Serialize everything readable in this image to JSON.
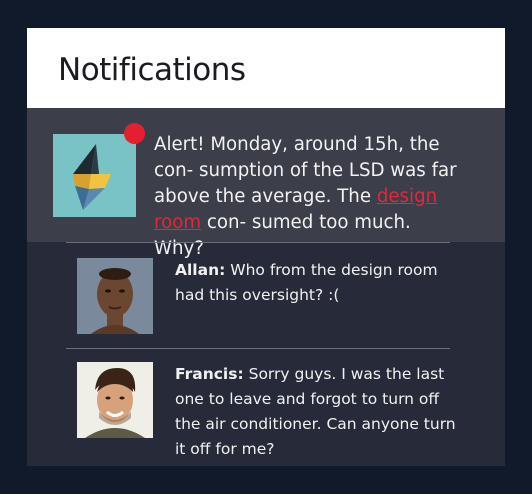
{
  "header": {
    "title": "Notifications"
  },
  "alert": {
    "text_before": "Alert! Monday, around 15h, the con- sumption of the LSD was far above the average. The ",
    "link_text": "design room",
    "text_after": " con- sumed too much. Why?",
    "icon": "lightning-bolt-icon",
    "badge_color": "#e61f30",
    "link_color": "#e2283a"
  },
  "comments": [
    {
      "author": "Allan:",
      "text": " Who from the design room had this oversight? :("
    },
    {
      "author": "Francis:",
      "text": " Sorry guys. I was the last one to leave and forgot to turn off the air conditioner. Can anyone turn it off for me?"
    }
  ],
  "colors": {
    "page_background": "#111a2b",
    "panel_background": "#272b39",
    "alert_background": "#3c3e4a",
    "header_background": "#ffffff",
    "icon_background": "#79c2c6"
  }
}
